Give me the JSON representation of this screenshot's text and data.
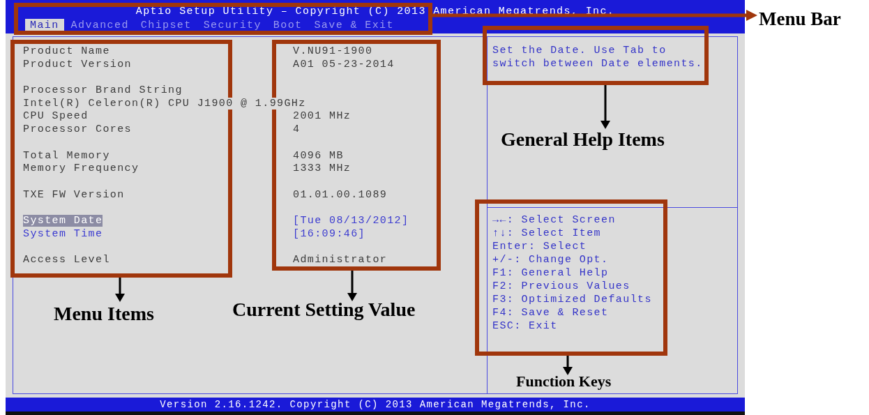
{
  "title": "Aptio Setup Utility – Copyright (C) 2013 American Megatrends, Inc.",
  "tabs": [
    {
      "label": "Main",
      "selected": true
    },
    {
      "label": "Advanced",
      "selected": false
    },
    {
      "label": "Chipset",
      "selected": false
    },
    {
      "label": "Security",
      "selected": false
    },
    {
      "label": "Boot",
      "selected": false
    },
    {
      "label": "Save & Exit",
      "selected": false
    }
  ],
  "groups": [
    [
      {
        "kind": "info",
        "label": "Product Name",
        "value": "V.NU91-1900"
      },
      {
        "kind": "info",
        "label": "Product Version",
        "value": "A01 05-23-2014"
      }
    ],
    [
      {
        "kind": "info",
        "label": "Processor Brand String"
      },
      {
        "kind": "text",
        "label": "Intel(R) Celeron(R) CPU J1900 @ 1.99GHz"
      },
      {
        "kind": "info",
        "label": "CPU Speed",
        "value": "2001 MHz"
      },
      {
        "kind": "info",
        "label": "Processor Cores",
        "value": "4"
      }
    ],
    [
      {
        "kind": "info",
        "label": "Total Memory",
        "value": "4096 MB"
      },
      {
        "kind": "info",
        "label": "Memory Frequency",
        "value": "1333 MHz"
      }
    ],
    [
      {
        "kind": "info",
        "label": "TXE FW Version",
        "value": "01.01.00.1089"
      }
    ],
    [
      {
        "kind": "setting",
        "label": "System Date",
        "value": "[Tue 08/13/2012]",
        "selected": true
      },
      {
        "kind": "setting",
        "label": "System Time",
        "value": "[16:09:46]",
        "selected": false
      }
    ],
    [
      {
        "kind": "info",
        "label": "Access Level",
        "value": "Administrator"
      }
    ]
  ],
  "help": "Set the Date. Use Tab to switch between Date elements.",
  "keys": [
    "→←: Select Screen",
    "↑↓: Select Item",
    "Enter: Select",
    "+/-: Change Opt.",
    "F1: General Help",
    "F2: Previous Values",
    "F3: Optimized Defaults",
    "F4: Save & Reset",
    "ESC: Exit"
  ],
  "footer": "Version 2.16.1242. Copyright (C) 2013 American Megatrends, Inc.",
  "annotations": [
    "Menu Bar",
    "General Help Items",
    "Menu Items",
    "Current Setting Value",
    "Function Keys"
  ]
}
